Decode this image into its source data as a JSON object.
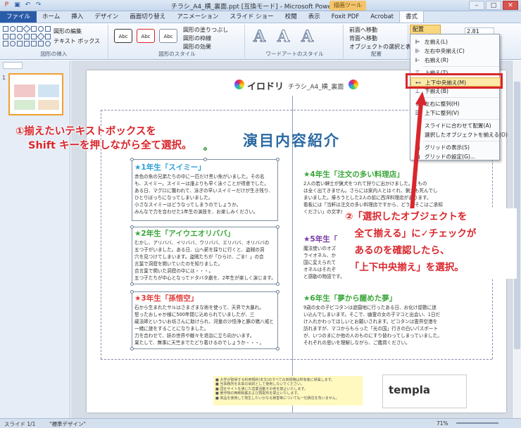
{
  "window": {
    "title": "チラシ_A4_横_裏面.ppt [互換モード] - Microsoft PowerPoint",
    "context_tab": "描画ツール"
  },
  "tabs": [
    "ファイル",
    "ホーム",
    "挿入",
    "デザイン",
    "画面切り替え",
    "アニメーション",
    "スライド ショー",
    "校閲",
    "表示",
    "Foxit PDF",
    "Acrobat",
    "書式"
  ],
  "ribbon": {
    "insert_shape_group": "図形の挿入",
    "edit_shape": "図形の編集",
    "text_box": "テキスト ボックス",
    "shape_styles_group": "図形のスタイル",
    "style_label": "Abc",
    "shape_fill": "図形の塗りつぶし",
    "shape_outline": "図形の枠線",
    "shape_effects": "図形の効果",
    "wordart_group": "ワードアートのスタイル",
    "wordart_letter": "A",
    "bring_forward": "前面へ移動",
    "send_backward": "背面へ移動",
    "selection_pane": "オブジェクトの選択と表示",
    "arrange_group": "配置",
    "align_button": "配置",
    "size_group": "サイズ",
    "size_value": "2.81"
  },
  "align_menu": {
    "items": [
      {
        "icon": "align-left-icon",
        "label": "左揃え(L)"
      },
      {
        "icon": "align-center-icon",
        "label": "左右中央揃え(C)"
      },
      {
        "icon": "align-right-icon",
        "label": "右揃え(R)"
      },
      {
        "icon": "align-top-icon",
        "label": "上揃え(T)"
      },
      {
        "icon": "align-middle-icon",
        "label": "上下中央揃え(M)"
      },
      {
        "icon": "align-bottom-icon",
        "label": "下揃え(B)"
      },
      {
        "icon": "distribute-horizontal-icon",
        "label": "左右に整列(H)"
      },
      {
        "icon": "distribute-vertical-icon",
        "label": "上下に整列(V)"
      },
      {
        "icon": "",
        "label": "スライドに合わせて配置(A)"
      },
      {
        "icon": "check-icon",
        "label": "選択したオブジェクトを揃える(O)"
      },
      {
        "icon": "grid-icon",
        "label": "グリッドの表示(S)"
      },
      {
        "icon": "grid-settings-icon",
        "label": "グリッドの設定(G)..."
      }
    ],
    "highlighted": "上下中央揃え(M)"
  },
  "slide": {
    "logo_text": "イロドリ",
    "logo_title": "チラシ_A4_横_裏面",
    "main_title": "演目内容紹介",
    "boxes": [
      {
        "heading": "★1年生「スイミー」",
        "color": "#2d9fd8",
        "body": "赤色の魚の兄弟たちの中に一匹だけ黒い魚がいました。その名\nも、スイミー。スイミーは誰よりも早く泳ぐことが得意でした。\nある日、マグロに襲われて、泳ぎの早いスイミーだけが生き残り、\nひとりぼっちになってしまいました。\n小さなスイミーはどうなってしまうのでしょうか。\nみんなで力を合わせた1年生の演技を、お楽しみください。"
      },
      {
        "heading": "★2年生「アイウエオリババ」",
        "color": "#3aa63a",
        "body": "むかし、アリババ、イリババ、ウリババ、エリババ、オリババの\n五つ子がいました。ある日、山へ薪を採りに行くと、盗賊の洞\n穴を見つけてしまいます。盗賊たちが「ひらけ、ごま！」の合\n言葉で洞窟を開いていたのを知りました。\n合言葉で開いた洞窟の中には・・・。\n五つ子たちが中心となってドタバタ劇を、2年生が楽しく演じます。"
      },
      {
        "heading": "★3年生「孫悟空」",
        "color": "#e23a3a",
        "body": "石から生まれたサルはさまざまな術を使って、天界で大暴れ。\n怒ったおしゃか様に500年閉じ込められていましたが、三\n蔵法師といういお坊さんに助けられ、河童の沙悟浄と豚の猪八戒と\n一緒に旅をすることになりました。\n力を合わせて、妖の世界や敵々を退治に立ち向かいます。\n果たして、無事に天竺までたどり着けるのでしょうか・・・。"
      },
      {
        "heading": "★4年生「注文の多い料理店」",
        "color": "#3aa63a",
        "body": "2人の若い紳士が猟犬をつれて狩りに出かけました。えもの\nは全く出てきません。さらには案内人とはぐれ、猟犬も死んでし\nまいました。帰ろうとした2人の前に西洋料理店があります。\n看板には「当軒は注文の多い料理店ですから、どうかそこはご承知\nください」の文字が・・・。"
      },
      {
        "heading": "★5年生「",
        "color": "#7a3aa6",
        "body": "魔法使いのオズ\nライオネル、か\n国に変えられて\nオネルはそれぞ\nと感動の物語です。"
      },
      {
        "heading": "★6年生「夢から醒めた夢」",
        "color": "#3aa63a",
        "body": "9歳の女の子ピコタンは遊園地に行ったある日、お化け屋敷に迷\nい込んでしまいます。そこで、幽霊の女の子マコと出会い、1日だ\nけ入れかわってほしいとお願いされます。ピコタンは霊界空港を\n訪れますが、マコからもらった「光の国」行きの白いパスポート\nが、いつのまにか他の人のものにすり替わってしまっていました。\nそれぞれの思いを理解しながら、ご鑑賞ください。"
      }
    ],
    "footer_notes": "■ 大学が取得する利用規約(本文)のすべての商標権は所有者に帰属します。\n■ 当事務所を本来の目的として使用しないでください。\n■ 同社サイトを通じた営業活動その他を禁止いたします。\n■ 著作物の無断転載および再配布を禁止いたします。\n■ 商品を使用して発生したいかなる損害等についても一切責任を負いません。",
    "template_text": "templa"
  },
  "callouts": {
    "step1_line1": "①揃えたいテキストボックスを",
    "step1_line2": "Shift キーを押しながら全て選択。",
    "step2": "②「選択したオブジェクトを\n　全て揃える」に✓チェックが\n　あるのを確認したら、\n　「上下中央揃え」を選択。"
  },
  "status": {
    "slide": "スライド 1/1",
    "theme": "\"標準デザイン\"",
    "zoom": "71%"
  },
  "colors": {
    "accent_red": "#d9262c",
    "title_blue": "#2c6aa3",
    "file_tab": "#2a5ba8"
  }
}
